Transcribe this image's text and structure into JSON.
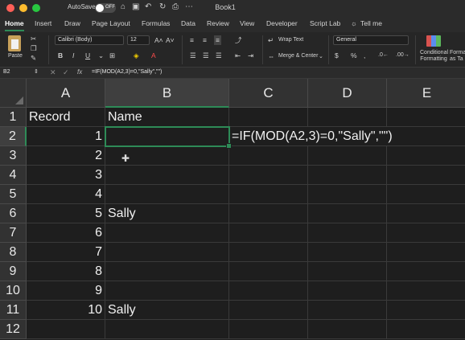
{
  "titlebar": {
    "autosave_label": "AutoSave",
    "autosave_state": "OFF",
    "window_title": "Book1",
    "colors": {
      "close": "#ff5f57",
      "minimize": "#febc2e",
      "zoom": "#28c840"
    }
  },
  "tabs": [
    "Home",
    "Insert",
    "Draw",
    "Page Layout",
    "Formulas",
    "Data",
    "Review",
    "View",
    "Developer",
    "Script Lab",
    "Tell me"
  ],
  "ribbon": {
    "paste_label": "Paste",
    "font_name": "Calibri (Body)",
    "font_size": "12",
    "bold": "B",
    "italic": "I",
    "underline": "U",
    "increase_font": "A˄",
    "decrease_font": "A˅",
    "font_color_glyph": "A",
    "wrap_text": "Wrap Text",
    "merge_center": "Merge & Center",
    "number_format": "General",
    "conditional_formatting": "Conditional Formatting",
    "format_as_table": "Format as Ta",
    "accent": "#2e8b57"
  },
  "formula_bar": {
    "name_box": "B2",
    "fx": "fx",
    "formula": "=IF(MOD(A2,3)=0,\"Sally\",\"\")"
  },
  "sheet": {
    "columns": [
      "A",
      "B",
      "C",
      "D",
      "E"
    ],
    "rows": [
      {
        "n": "1",
        "a": "Record",
        "b": "Name"
      },
      {
        "n": "2",
        "a": "1",
        "b": ""
      },
      {
        "n": "3",
        "a": "2",
        "b": ""
      },
      {
        "n": "4",
        "a": "3",
        "b": ""
      },
      {
        "n": "5",
        "a": "4",
        "b": ""
      },
      {
        "n": "6",
        "a": "5",
        "b": "Sally"
      },
      {
        "n": "7",
        "a": "6",
        "b": ""
      },
      {
        "n": "8",
        "a": "7",
        "b": ""
      },
      {
        "n": "9",
        "a": "8",
        "b": ""
      },
      {
        "n": "10",
        "a": "9",
        "b": ""
      },
      {
        "n": "11",
        "a": "10",
        "b": "Sally"
      },
      {
        "n": "12",
        "a": "",
        "b": ""
      }
    ],
    "overflow_text": "=IF(MOD(A2,3)=0,\"Sally\",\"\")",
    "cursor_glyph": "✚"
  }
}
